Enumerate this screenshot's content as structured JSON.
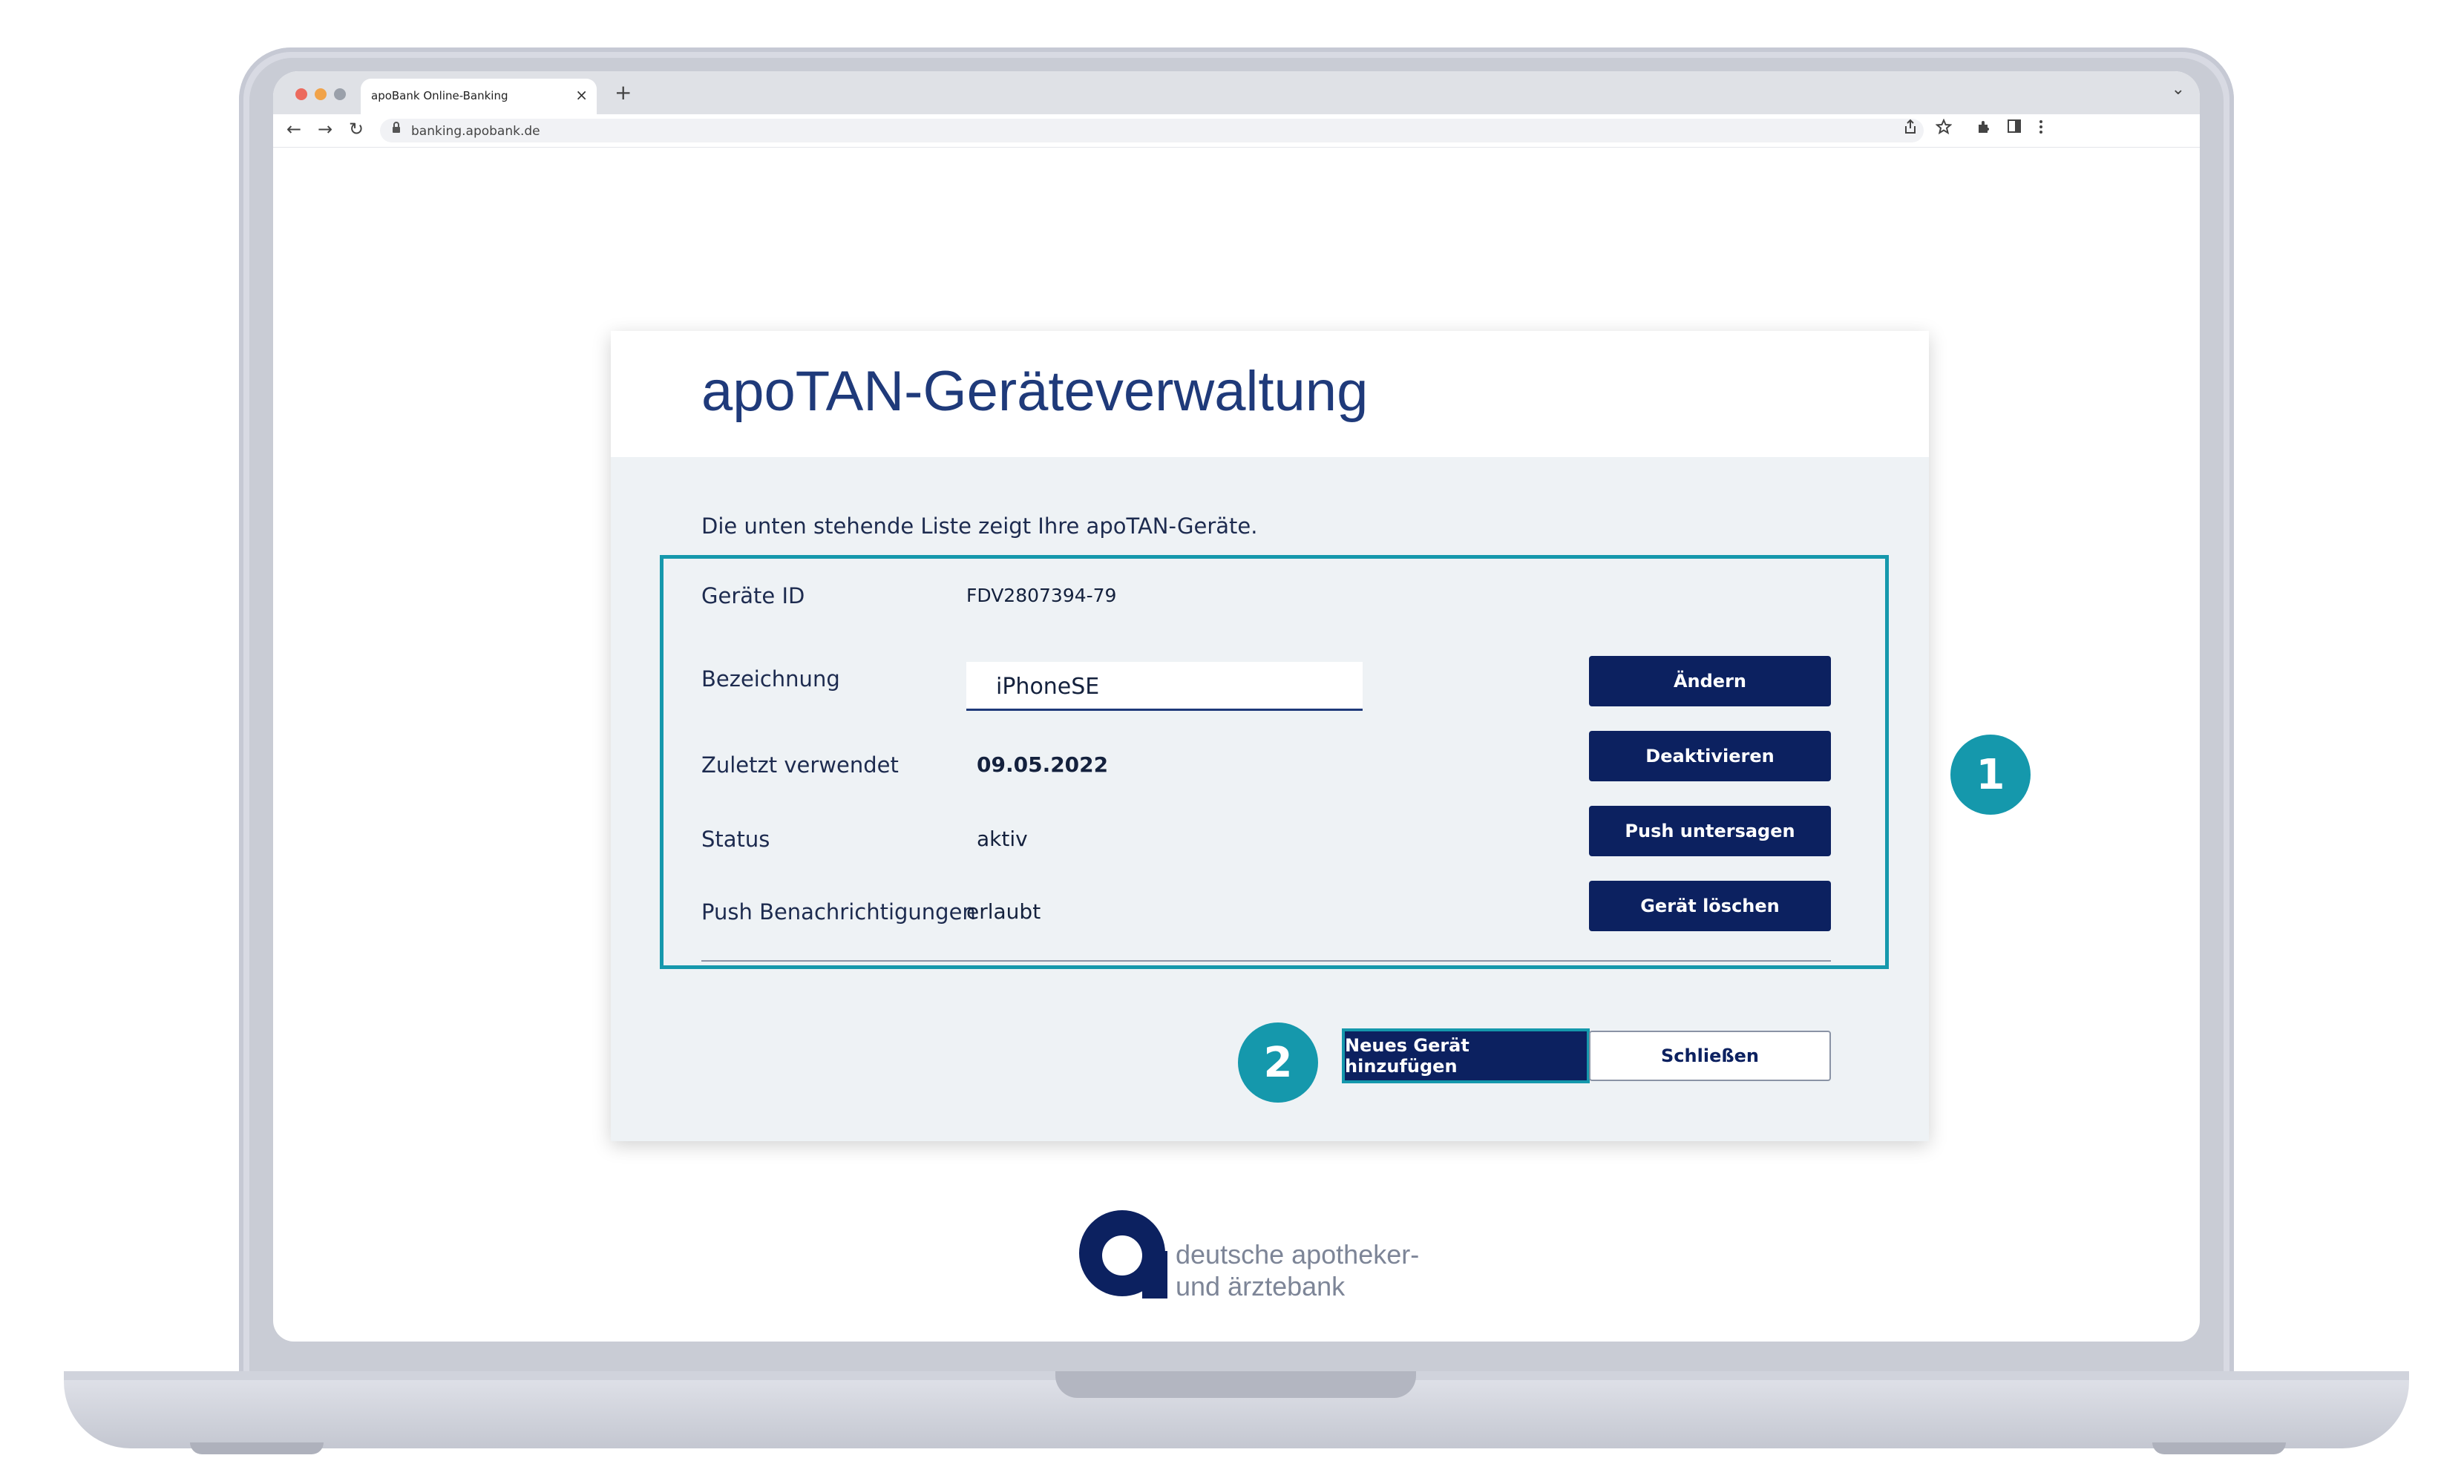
{
  "browser": {
    "tab_title": "apoBank Online-Banking",
    "tab_close": "×",
    "new_tab": "+",
    "tab_list": "⌄",
    "url": "banking.apobank.de",
    "nav": {
      "back": "←",
      "forward": "→",
      "reload": "↻",
      "lock": "🔒"
    },
    "toolbar_icons": [
      "share-icon",
      "star-icon",
      "extensions-icon",
      "sidepanel-icon",
      "menu-icon"
    ]
  },
  "dialog": {
    "title": "apoTAN-Geräteverwaltung",
    "intro": "Die unten stehende Liste zeigt Ihre apoTAN-Geräte.",
    "fields": {
      "device_id_label": "Geräte ID",
      "device_id_value": "FDV2807394-79",
      "name_label": "Bezeichnung",
      "name_value": "iPhoneSE",
      "last_used_label": "Zuletzt verwendet",
      "last_used_value": "09.05.2022",
      "status_label": "Status",
      "status_value": "aktiv",
      "push_label": "Push Benachrichtigungen",
      "push_value": "erlaubt"
    },
    "buttons": {
      "change": "Ändern",
      "deactivate": "Deaktivieren",
      "forbid_push": "Push untersagen",
      "delete_device": "Gerät löschen",
      "add_device": "Neues Gerät hinzufügen",
      "close": "Schließen"
    },
    "markers": {
      "one": "1",
      "two": "2"
    }
  },
  "logo": {
    "line1": "deutsche apotheker-",
    "line2": "und ärztebank"
  },
  "colors": {
    "primary": "#0c2160",
    "title": "#1f3a7a",
    "accent": "#1598ac",
    "dialog_bg": "#eef2f5"
  }
}
